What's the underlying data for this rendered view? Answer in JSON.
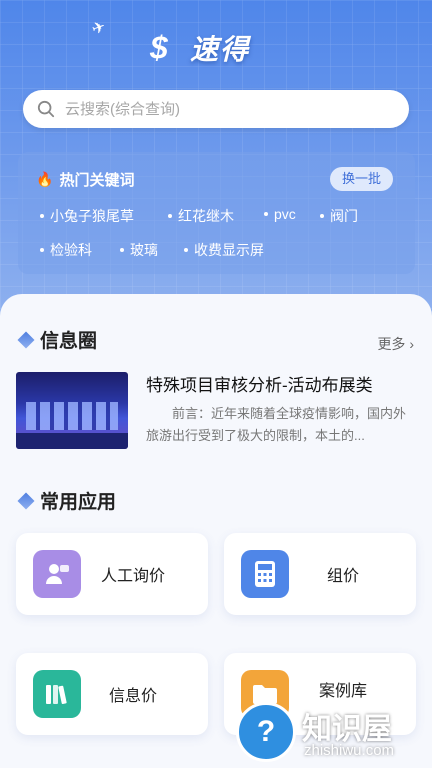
{
  "app": {
    "logo_mark": "$",
    "logo_text": "速得"
  },
  "search": {
    "placeholder": "云搜索(综合查询)"
  },
  "hot_keywords": {
    "title": "热门关键词",
    "refresh_label": "换一批",
    "items": [
      "小兔子狼尾草",
      "红花继木",
      "pvc",
      "阀门",
      "检验科",
      "玻璃",
      "收费显示屏"
    ]
  },
  "info_section": {
    "title": "信息圈",
    "more_label": "更多",
    "article": {
      "title": "特殊项目审核分析-活动布展类",
      "summary": "前言：近年来随着全球疫情影响，国内外旅游出行受到了极大的限制，本土的..."
    }
  },
  "apps_section": {
    "title": "常用应用",
    "items": [
      {
        "label": "人工询价",
        "icon": "person-chat-icon",
        "color": "#a88de6"
      },
      {
        "label": "组价",
        "icon": "calculator-icon",
        "color": "#4f86e8"
      },
      {
        "label": "信息价",
        "icon": "books-icon",
        "color": "#2ab79a"
      },
      {
        "label": "案例库",
        "icon": "folder-icon",
        "color": "#f3a53a"
      }
    ]
  },
  "watermark": {
    "text": "知识屋",
    "sub": "zhishiwu.com",
    "mark": "?"
  }
}
